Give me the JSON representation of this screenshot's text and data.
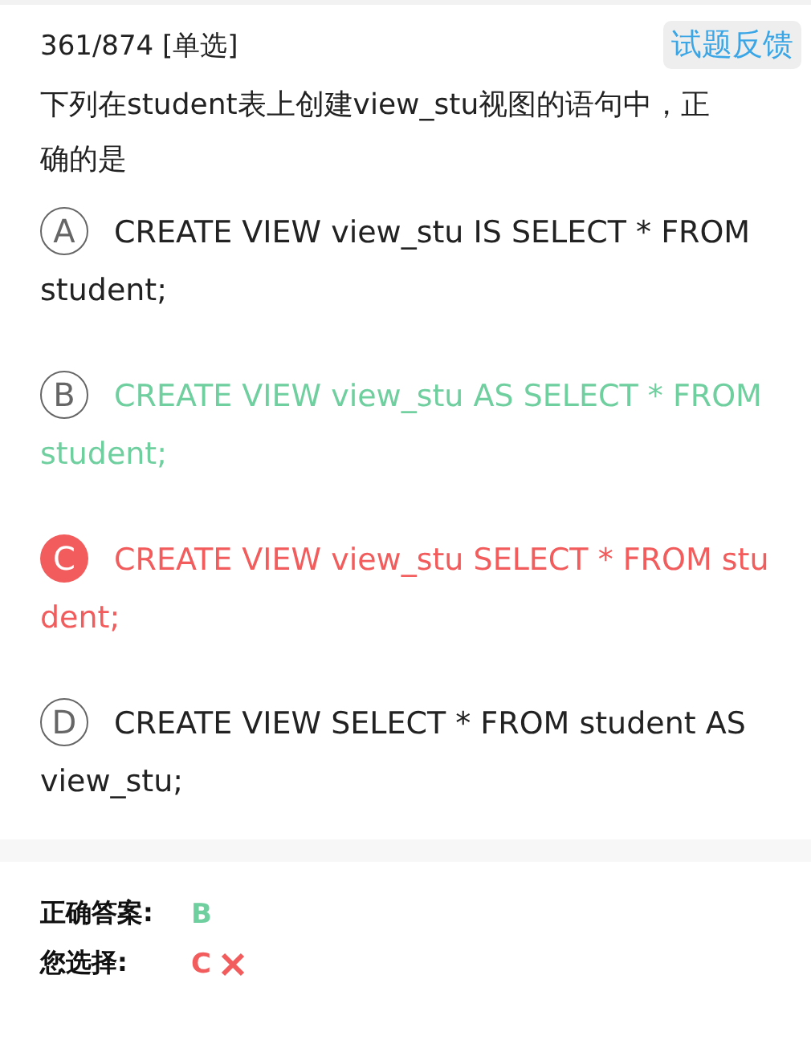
{
  "header": {
    "progress": "361/874 [单选]",
    "feedback_button": "试题反馈"
  },
  "question": "下列在student表上创建view_stu视图的语句中，正确的是",
  "options": [
    {
      "letter": "A",
      "text": "CREATE VIEW view_stu IS SELECT * FROM student;",
      "selected": false,
      "correct": false
    },
    {
      "letter": "B",
      "text": "CREATE VIEW view_stu AS SELECT * FROM student;",
      "selected": false,
      "correct": true
    },
    {
      "letter": "C",
      "text": "CREATE VIEW view_stu SELECT * FROM student;",
      "selected": true,
      "correct": false
    },
    {
      "letter": "D",
      "text": "CREATE VIEW SELECT * FROM student AS view_stu;",
      "selected": false,
      "correct": false
    }
  ],
  "result": {
    "correct_label": "正确答案:",
    "correct_value": "B",
    "chosen_label": "您选择:",
    "chosen_value": "C",
    "chosen_is_correct": false
  }
}
